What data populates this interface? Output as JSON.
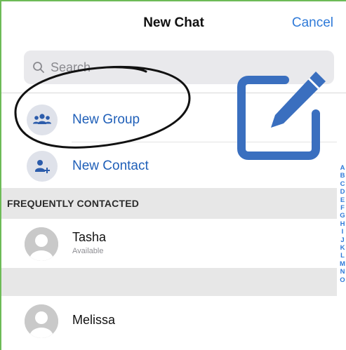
{
  "header": {
    "title": "New Chat",
    "cancel_label": "Cancel"
  },
  "search": {
    "placeholder": "Search"
  },
  "actions": [
    {
      "label": "New Group",
      "icon": "group-icon"
    },
    {
      "label": "New Contact",
      "icon": "add-contact-icon"
    }
  ],
  "section": {
    "title": "FREQUENTLY CONTACTED"
  },
  "contacts": [
    {
      "name": "Tasha",
      "status": "Available"
    },
    {
      "name": "Melissa",
      "status": ""
    }
  ],
  "alphabet": [
    "A",
    "B",
    "C",
    "D",
    "E",
    "F",
    "G",
    "H",
    "I",
    "J",
    "K",
    "L",
    "M",
    "N",
    "O"
  ],
  "colors": {
    "accent": "#2f7ad8",
    "action_text": "#1f5fb8",
    "compose_icon": "#3a6fbf",
    "section_bg": "#e7e7e7"
  },
  "overlays": {
    "annotation": "hand-drawn-ellipse",
    "icon": "compose-icon"
  }
}
